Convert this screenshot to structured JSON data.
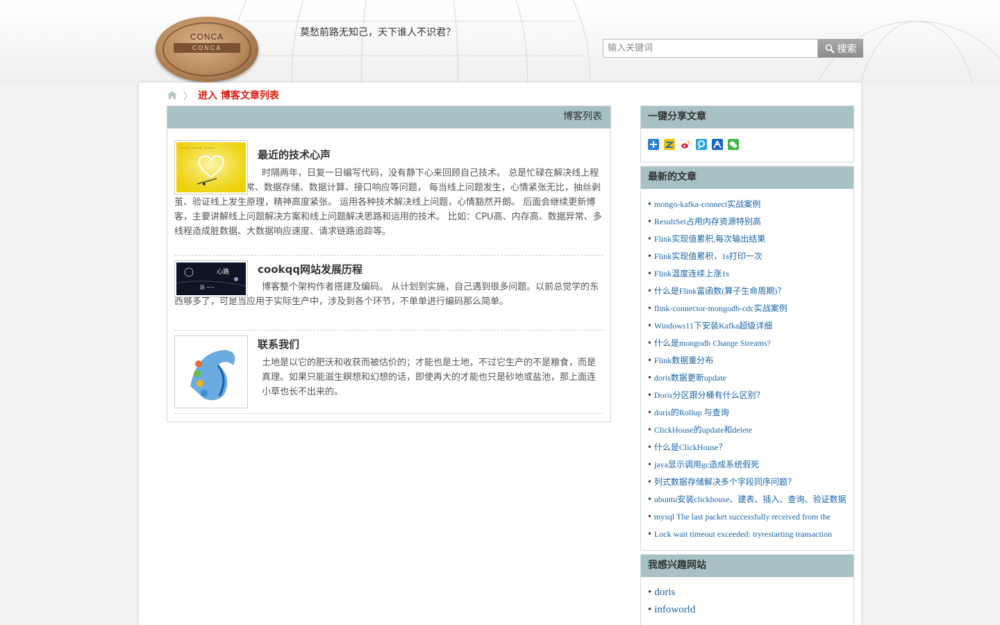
{
  "header": {
    "logo_text": "CONCA",
    "logo_ribbon": "CONCA",
    "slogan": "莫愁前路无知己，天下谁人不识君？",
    "search_placeholder": "输入关键词",
    "search_button": "搜索"
  },
  "breadcrumb": {
    "separator": "〉",
    "label": "进入 博客文章列表"
  },
  "main": {
    "header": "博客列表",
    "posts": [
      {
        "title": "最近的技术心声",
        "summary": "时隔两年，日复一日编写代码，没有静下心来回顾自己技术。 总是忙碌在解决线上程序bug、服务器异常、数据存储、数据计算、接口响应等问题， 每当线上问题发生，心情紧张无比，抽丝剥茧、验证线上发生原理，精神高度紧张。 运用各种技术解决线上问题，心情豁然开朗。 后面会继续更新博客，主要讲解线上问题解决方案和线上问题解决思路和运用的技术。 比如：CPU高、内存高、数据异常、多线程造成脏数据、大数据响应速度、请求链路追踪等。"
      },
      {
        "title": "cookqq网站发展历程",
        "summary": "博客整个架构作者搭建及编码。 从计划到实施，自己遇到很多问题。以前总觉学的东西够多了，可是当应用于实际生产中，涉及到各个环节，不单单进行编码那么简单。"
      },
      {
        "title": "联系我们",
        "summary": "土地是以它的肥沃和收获而被估价的；才能也是土地，不过它生产的不是粮食，而是真理。如果只能滋生瞑想和幻想的话，即使再大的才能也只是砂地或盐池，那上面连小草也长不出来的。"
      }
    ]
  },
  "sidebar": {
    "share": {
      "title": "一键分享文章",
      "icons": [
        "more-icon",
        "qzone-icon",
        "weibo-icon",
        "tencent-weibo-icon",
        "renren-icon",
        "wechat-icon"
      ]
    },
    "latest": {
      "title": "最新的文章",
      "bullet": "•",
      "items": [
        "mongo-kafka-connect实战案例",
        "ResultSet占用内存资源特别高",
        "Flink实现值累积,每次输出结果",
        "Flink实现值累积，1s打印一次",
        "Flink温度连续上涨1s",
        "什么是Flink富函数(算子生命周期)？",
        "flink-connector-mongodb-cdc实战案例",
        "Windows11下安装Kafka超级详细",
        "什么是mongodb Change Streams?",
        "Flink数据重分布",
        "doris数据更新update",
        "Doris分区跟分桶有什么区别？",
        "doris的Rollup 与查询",
        "ClickHouse的update和delete",
        "什么是ClickHouse？",
        "java显示调用gc造成系统假死",
        "列式数据存储解决多个字段同序问题？",
        "ubuntu安装clickhouse、建表、插入、查询、验证数据",
        "mysql The last packet successfully received from the",
        "Lock wait timeout exceeded: tryrestarting transaction"
      ]
    },
    "sites": {
      "title": "我感兴趣网站",
      "bullet": "•",
      "items": [
        "doris",
        "infoworld"
      ]
    }
  },
  "colors": {
    "panel_header": "#a7c1c5",
    "link": "#1a63a8",
    "breadcrumb_link": "#e0180c"
  }
}
